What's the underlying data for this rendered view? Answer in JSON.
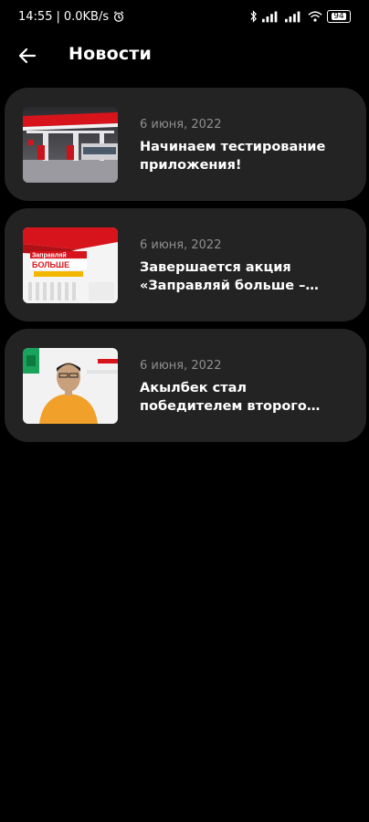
{
  "status": {
    "time": "14:55",
    "net_speed": "0.0KB/s",
    "separator": "|",
    "battery": "94"
  },
  "appbar": {
    "title": "Новости"
  },
  "news": [
    {
      "date": "6 июня, 2022",
      "headline": "Начинаем тестирование приложения!"
    },
    {
      "date": "6 июня, 2022",
      "headline": "Завершается акция «Заправляй больше – плати меньше»",
      "thumb_text_1": "Заправляй",
      "thumb_text_2": "БОЛЬШЕ"
    },
    {
      "date": "6 июня, 2022",
      "headline": "Акылбек стал победителем второго этапа розыгрыша «Пу"
    }
  ],
  "colors": {
    "background": "#000000",
    "card": "#232323",
    "date": "#8f8f8f",
    "brand_red": "#d7141b"
  }
}
